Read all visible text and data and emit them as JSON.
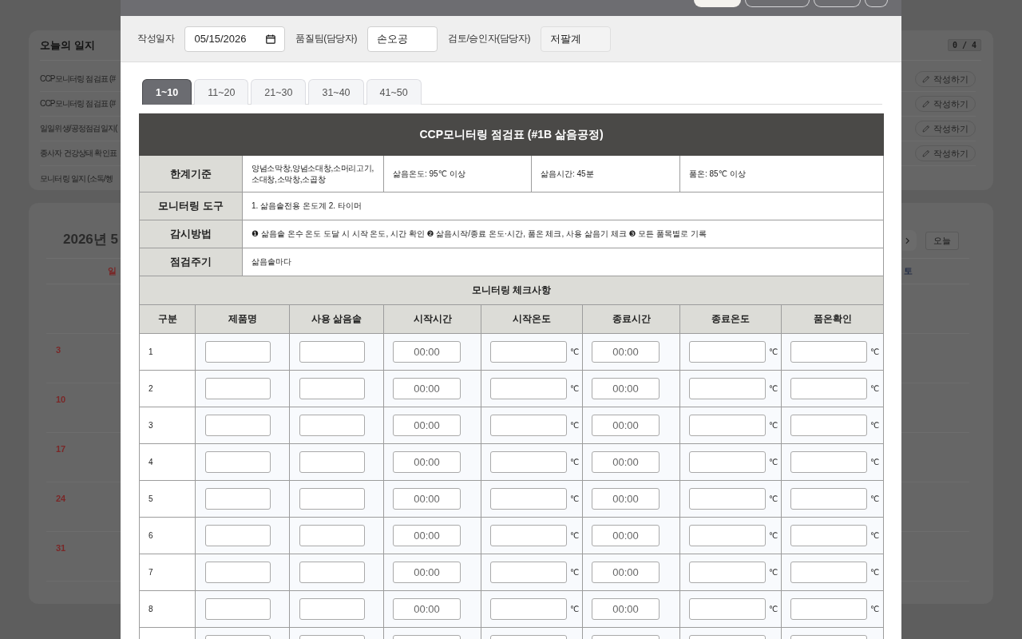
{
  "background": {
    "daily_log": {
      "title": "오늘의 일지",
      "count": "0 / 4",
      "items": [
        {
          "title": "CCP모니터링 점검표 (#",
          "action": "작성하기"
        },
        {
          "title": "CCP모니터링 점검표 (#",
          "action": "작성하기"
        },
        {
          "title": "일일위생/공정점검일지(",
          "action": "작성하기"
        },
        {
          "title": "종사자 건강상태 확인표",
          "action": "작성하기"
        },
        {
          "title": "모니터링 일지 (소독/헹"
        }
      ]
    },
    "calendar": {
      "title": "2026년 5",
      "today_button": "오늘",
      "weekdays": [
        {
          "label": "일",
          "kind": "sun"
        },
        {
          "label": "토",
          "kind": "sat"
        }
      ],
      "weeks": [
        {
          "sunday": "3"
        },
        {
          "sunday": "10"
        },
        {
          "sunday": "17"
        },
        {
          "sunday": "24"
        },
        {
          "sunday": "31"
        }
      ]
    }
  },
  "modal": {
    "header_buttons": [
      {
        "kind": "filled"
      },
      {
        "kind": "outline"
      },
      {
        "kind": "outline"
      },
      {
        "kind": "outline"
      }
    ],
    "fields": [
      {
        "label": "작성일자",
        "kind": "date",
        "value": "05/15/2026"
      },
      {
        "label": "품질팀(담당자)",
        "kind": "text",
        "value": "손오공"
      },
      {
        "label": "검토/승인자(담당자)",
        "kind": "readonly",
        "value": "저팔계"
      }
    ],
    "tabs": [
      {
        "label": "1~10",
        "selected": true
      },
      {
        "label": "11~20",
        "selected": false
      },
      {
        "label": "21~30",
        "selected": false
      },
      {
        "label": "31~40",
        "selected": false
      },
      {
        "label": "41~50",
        "selected": false
      }
    ],
    "sheet": {
      "title": "CCP모니터링 점검표 (#1B 삶음공정)",
      "criteria": {
        "label": "한계기준",
        "products": [
          "양념소막창,양념소대창,소머리고기,",
          "소대창,소막창,소곱창"
        ],
        "limits": [
          "삶음온도: 95℃ 이상",
          "삶음시간: 45분",
          "품온: 85℃ 이상"
        ]
      },
      "rows": [
        {
          "label": "모니터링 도구",
          "text": "1. 삶음솥전용 온도계 2. 타이머"
        },
        {
          "label": "감시방법",
          "text": "❶ 삶음솥 온수 온도 도달 시 시작 온도, 시간 확인 ❷ 삶음시작/종료 온도·시간, 품온 체크, 사용 삶음기 체크 ❸ 모든 품목별로 기록"
        },
        {
          "label": "점검주기",
          "text": "삶음솥마다"
        }
      ]
    },
    "checklist": {
      "title": "모니터링 체크사항",
      "columns": [
        "구분",
        "제품명",
        "사용 삶음솥",
        "시작시간",
        "시작온도",
        "종료시간",
        "종료온도",
        "품온확인"
      ],
      "rows": [
        {
          "cells": [
            {
              "kind": "no",
              "text": "1"
            },
            {
              "kind": "text"
            },
            {
              "kind": "text"
            },
            {
              "kind": "time",
              "placeholder": "00:00"
            },
            {
              "kind": "temp",
              "unit": "℃"
            },
            {
              "kind": "time",
              "placeholder": "00:00"
            },
            {
              "kind": "temp",
              "unit": "℃"
            },
            {
              "kind": "temp",
              "unit": "℃"
            }
          ]
        },
        {
          "cells": [
            {
              "kind": "no",
              "text": "2"
            },
            {
              "kind": "text"
            },
            {
              "kind": "text"
            },
            {
              "kind": "time",
              "placeholder": "00:00"
            },
            {
              "kind": "temp",
              "unit": "℃"
            },
            {
              "kind": "time",
              "placeholder": "00:00"
            },
            {
              "kind": "temp",
              "unit": "℃"
            },
            {
              "kind": "temp",
              "unit": "℃"
            }
          ]
        },
        {
          "cells": [
            {
              "kind": "no",
              "text": "3"
            },
            {
              "kind": "text"
            },
            {
              "kind": "text"
            },
            {
              "kind": "time",
              "placeholder": "00:00"
            },
            {
              "kind": "temp",
              "unit": "℃"
            },
            {
              "kind": "time",
              "placeholder": "00:00"
            },
            {
              "kind": "temp",
              "unit": "℃"
            },
            {
              "kind": "temp",
              "unit": "℃"
            }
          ]
        },
        {
          "cells": [
            {
              "kind": "no",
              "text": "4"
            },
            {
              "kind": "text"
            },
            {
              "kind": "text"
            },
            {
              "kind": "time",
              "placeholder": "00:00"
            },
            {
              "kind": "temp",
              "unit": "℃"
            },
            {
              "kind": "time",
              "placeholder": "00:00"
            },
            {
              "kind": "temp",
              "unit": "℃"
            },
            {
              "kind": "temp",
              "unit": "℃"
            }
          ]
        },
        {
          "cells": [
            {
              "kind": "no",
              "text": "5"
            },
            {
              "kind": "text"
            },
            {
              "kind": "text"
            },
            {
              "kind": "time",
              "placeholder": "00:00"
            },
            {
              "kind": "temp",
              "unit": "℃"
            },
            {
              "kind": "time",
              "placeholder": "00:00"
            },
            {
              "kind": "temp",
              "unit": "℃"
            },
            {
              "kind": "temp",
              "unit": "℃"
            }
          ]
        },
        {
          "cells": [
            {
              "kind": "no",
              "text": "6"
            },
            {
              "kind": "text"
            },
            {
              "kind": "text"
            },
            {
              "kind": "time",
              "placeholder": "00:00"
            },
            {
              "kind": "temp",
              "unit": "℃"
            },
            {
              "kind": "time",
              "placeholder": "00:00"
            },
            {
              "kind": "temp",
              "unit": "℃"
            },
            {
              "kind": "temp",
              "unit": "℃"
            }
          ]
        },
        {
          "cells": [
            {
              "kind": "no",
              "text": "7"
            },
            {
              "kind": "text"
            },
            {
              "kind": "text"
            },
            {
              "kind": "time",
              "placeholder": "00:00"
            },
            {
              "kind": "temp",
              "unit": "℃"
            },
            {
              "kind": "time",
              "placeholder": "00:00"
            },
            {
              "kind": "temp",
              "unit": "℃"
            },
            {
              "kind": "temp",
              "unit": "℃"
            }
          ]
        },
        {
          "cells": [
            {
              "kind": "no",
              "text": "8"
            },
            {
              "kind": "text"
            },
            {
              "kind": "text"
            },
            {
              "kind": "time",
              "placeholder": "00:00"
            },
            {
              "kind": "temp",
              "unit": "℃"
            },
            {
              "kind": "time",
              "placeholder": "00:00"
            },
            {
              "kind": "temp",
              "unit": "℃"
            },
            {
              "kind": "temp",
              "unit": "℃"
            }
          ]
        },
        {
          "cells": [
            {
              "kind": "no"
            },
            {
              "kind": "text"
            },
            {
              "kind": "text"
            },
            {
              "kind": "time"
            },
            {
              "kind": "temp"
            },
            {
              "kind": "time"
            },
            {
              "kind": "temp"
            },
            {
              "kind": "temp"
            }
          ]
        }
      ]
    }
  }
}
